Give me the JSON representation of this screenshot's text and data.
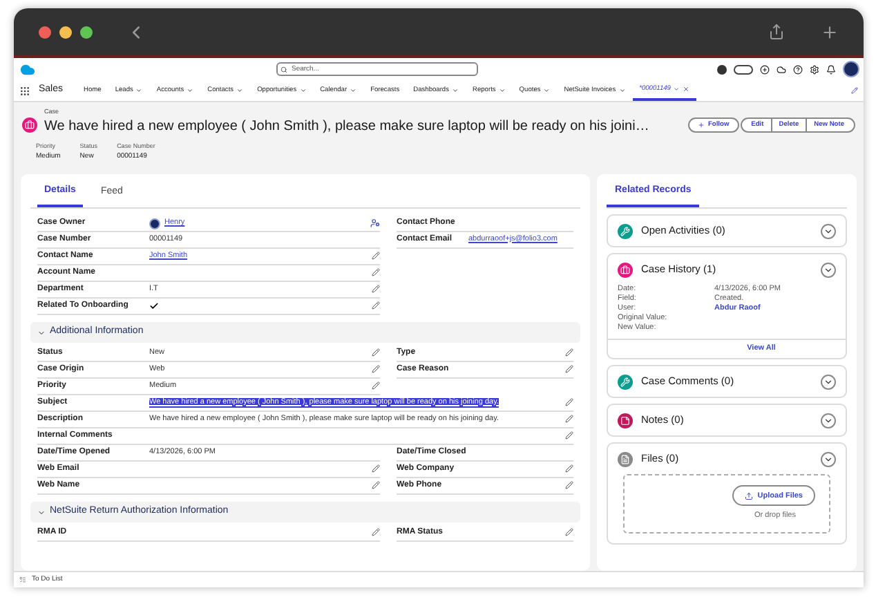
{
  "header": {
    "search_placeholder": "Search..."
  },
  "nav": {
    "app": "Sales",
    "items": [
      {
        "label": "Home",
        "kind": "plain",
        "selected": false
      },
      {
        "label": "Leads",
        "kind": "menu",
        "selected": false
      },
      {
        "label": "Accounts",
        "kind": "menu",
        "selected": false
      },
      {
        "label": "Contacts",
        "kind": "menu",
        "selected": false
      },
      {
        "label": "Opportunities",
        "kind": "menu",
        "selected": false
      },
      {
        "label": "Calendar",
        "kind": "menu",
        "selected": false
      },
      {
        "label": "Forecasts",
        "kind": "plain",
        "selected": false
      },
      {
        "label": "Dashboards",
        "kind": "menu",
        "selected": false
      },
      {
        "label": "Reports",
        "kind": "menu",
        "selected": false
      },
      {
        "label": "Quotes",
        "kind": "menu",
        "selected": false
      },
      {
        "label": "NetSuite Invoices",
        "kind": "menu",
        "selected": false
      },
      {
        "label": "*00001149",
        "kind": "record",
        "selected": true
      }
    ]
  },
  "record": {
    "object": "Case",
    "title": "We have hired a new employee ( John Smith ), please make sure laptop will be ready on his joini…",
    "buttons": [
      {
        "label": "Follow",
        "kind": "follow"
      },
      {
        "label": "Edit",
        "kind": "plain"
      },
      {
        "label": "Delete",
        "kind": "plain"
      },
      {
        "label": "New Note",
        "kind": "plain"
      }
    ],
    "highlights": [
      {
        "label": "Priority",
        "value": "Medium"
      },
      {
        "label": "Status",
        "value": "New"
      },
      {
        "label": "Case Number",
        "value": "00001149"
      }
    ]
  },
  "detail_tabs": [
    {
      "label": "Details",
      "selected": true
    },
    {
      "label": "Feed",
      "selected": false
    }
  ],
  "sections": [
    {
      "rows": [
        {
          "kind": "pair",
          "left": {
            "label": "Case Owner",
            "value": "Henry",
            "kind": "owner",
            "editable": false
          },
          "right": {
            "label": "Contact Phone",
            "editable": false
          }
        },
        {
          "kind": "pair",
          "left": {
            "label": "Case Number",
            "value": "00001149",
            "kind": "text",
            "editable": false
          },
          "right": {
            "label": "Contact Email",
            "value": "abdurraoof+js@folio3.com",
            "kind": "link",
            "editable": false
          }
        },
        {
          "kind": "pair",
          "left": {
            "label": "Contact Name",
            "value": "John Smith",
            "kind": "link",
            "editable": true
          }
        },
        {
          "kind": "pair",
          "left": {
            "label": "Account Name",
            "editable": true
          }
        },
        {
          "kind": "pair",
          "left": {
            "label": "Department",
            "value": "I.T",
            "kind": "text",
            "editable": true
          }
        },
        {
          "kind": "pair",
          "left": {
            "label": "Related To Onboarding",
            "kind": "check",
            "checked": true,
            "editable": true
          }
        }
      ]
    },
    {
      "title": "Additional Information",
      "rows": [
        {
          "kind": "pair",
          "left": {
            "label": "Status",
            "value": "New",
            "kind": "text",
            "editable": true
          },
          "right": {
            "label": "Type",
            "editable": true
          }
        },
        {
          "kind": "pair",
          "left": {
            "label": "Case Origin",
            "value": "Web",
            "kind": "text",
            "editable": true
          },
          "right": {
            "label": "Case Reason",
            "editable": true
          }
        },
        {
          "kind": "pair",
          "left": {
            "label": "Priority",
            "value": "Medium",
            "kind": "text",
            "editable": true
          }
        },
        {
          "kind": "wide",
          "field": {
            "label": "Subject",
            "value": "We have hired a new employee ( John Smith ), please make sure laptop will be ready on his joining day.",
            "kind": "text",
            "editable": true,
            "highlighted": true
          }
        },
        {
          "kind": "wide",
          "field": {
            "label": "Description",
            "value": "We have hired a new employee ( John Smith ), please make sure laptop will be ready on his joining day.",
            "kind": "text",
            "editable": true,
            "highlighted": false
          }
        },
        {
          "kind": "wide",
          "field": {
            "label": "Internal Comments",
            "editable": true
          }
        },
        {
          "kind": "pair",
          "left": {
            "label": "Date/Time Opened",
            "value": "4/13/2026, 6:00 PM",
            "kind": "text",
            "editable": false
          },
          "right": {
            "label": "Date/Time Closed",
            "editable": false
          }
        },
        {
          "kind": "pair",
          "left": {
            "label": "Web Email",
            "editable": true
          },
          "right": {
            "label": "Web Company",
            "editable": true
          }
        },
        {
          "kind": "pair",
          "left": {
            "label": "Web Name",
            "editable": true
          },
          "right": {
            "label": "Web Phone",
            "editable": true
          }
        }
      ]
    },
    {
      "title": "NetSuite Return Authorization Information",
      "rows": [
        {
          "kind": "pair",
          "left": {
            "label": "RMA ID",
            "editable": true
          },
          "right": {
            "label": "RMA Status",
            "editable": true
          }
        }
      ]
    }
  ],
  "related": {
    "title": "Related Records",
    "panels": [
      {
        "title": "Open Activities (0)",
        "kind": "activities",
        "color": "#0b9e8e"
      },
      {
        "title": "Case History (1)",
        "kind": "history",
        "color": "#e3197d",
        "entries": [
          {
            "label": "Date:",
            "value": "4/13/2026, 6:00 PM",
            "link": false
          },
          {
            "label": "Field:",
            "value": "Created.",
            "link": false
          },
          {
            "label": "User:",
            "value": "Abdur Raoof",
            "link": true
          },
          {
            "label": "Original Value:"
          },
          {
            "label": "New Value:"
          }
        ],
        "footer": "View All"
      },
      {
        "title": "Case Comments (0)",
        "kind": "comments",
        "color": "#0b9e8e"
      },
      {
        "title": "Notes (0)",
        "kind": "notes",
        "color": "#c2185b"
      },
      {
        "title": "Files (0)",
        "kind": "files",
        "color": "#8a8a8a",
        "upload": "Upload Files",
        "drop": "Or drop files"
      }
    ]
  },
  "utility_bar": {
    "label": "To Do List"
  }
}
